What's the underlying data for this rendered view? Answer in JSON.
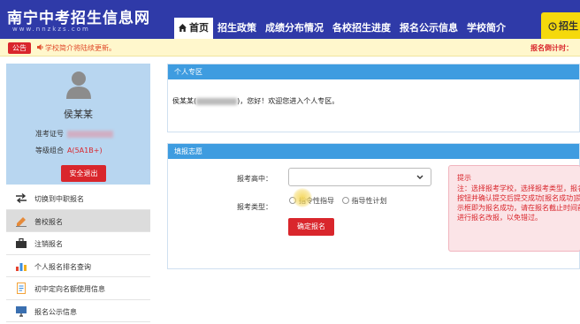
{
  "header": {
    "logo_title": "南宁中考招生信息网",
    "logo_url": "www.nnzkzs.com",
    "nav": [
      "首页",
      "招生政策",
      "成绩分布情况",
      "各校招生进度",
      "报名公示信息",
      "学校简介"
    ],
    "right_button": "招生"
  },
  "notice": {
    "badge": "公告",
    "text": "学校简介将陆续更新。",
    "countdown": "报名倒计时："
  },
  "profile": {
    "name": "侯某某",
    "ticket_label": "准考证号",
    "grade_label": "等级组合",
    "grade_value": "A(5A1B+)",
    "logout": "安全退出"
  },
  "menu": [
    {
      "label": "切换到中职报名",
      "icon": "switch-icon"
    },
    {
      "label": "普校报名",
      "icon": "edit-icon"
    },
    {
      "label": "注销报名",
      "icon": "briefcase-icon"
    },
    {
      "label": "个人报名排名查询",
      "icon": "bar-chart-icon"
    },
    {
      "label": "初中定向名额使用信息",
      "icon": "document-icon"
    },
    {
      "label": "报名公示信息",
      "icon": "monitor-icon"
    }
  ],
  "personal": {
    "title": "个人专区",
    "welcome_prefix": "侯某某(",
    "welcome_suffix": ")，您好！欢迎您进入个人专区。"
  },
  "form": {
    "title": "填报志愿",
    "school_label": "报考高中：",
    "type_label": "报考类型：",
    "options": [
      "指令性指导",
      "指导性计划"
    ],
    "submit": "确定报名"
  },
  "tip": {
    "title": "提示",
    "body": "注：选择报考学校，选择报考类型，报名按钮并确认提交后提交成功[报名成功]提示框即为报名成功，请在报名截止时间前进行报名改报，以免错过。"
  }
}
